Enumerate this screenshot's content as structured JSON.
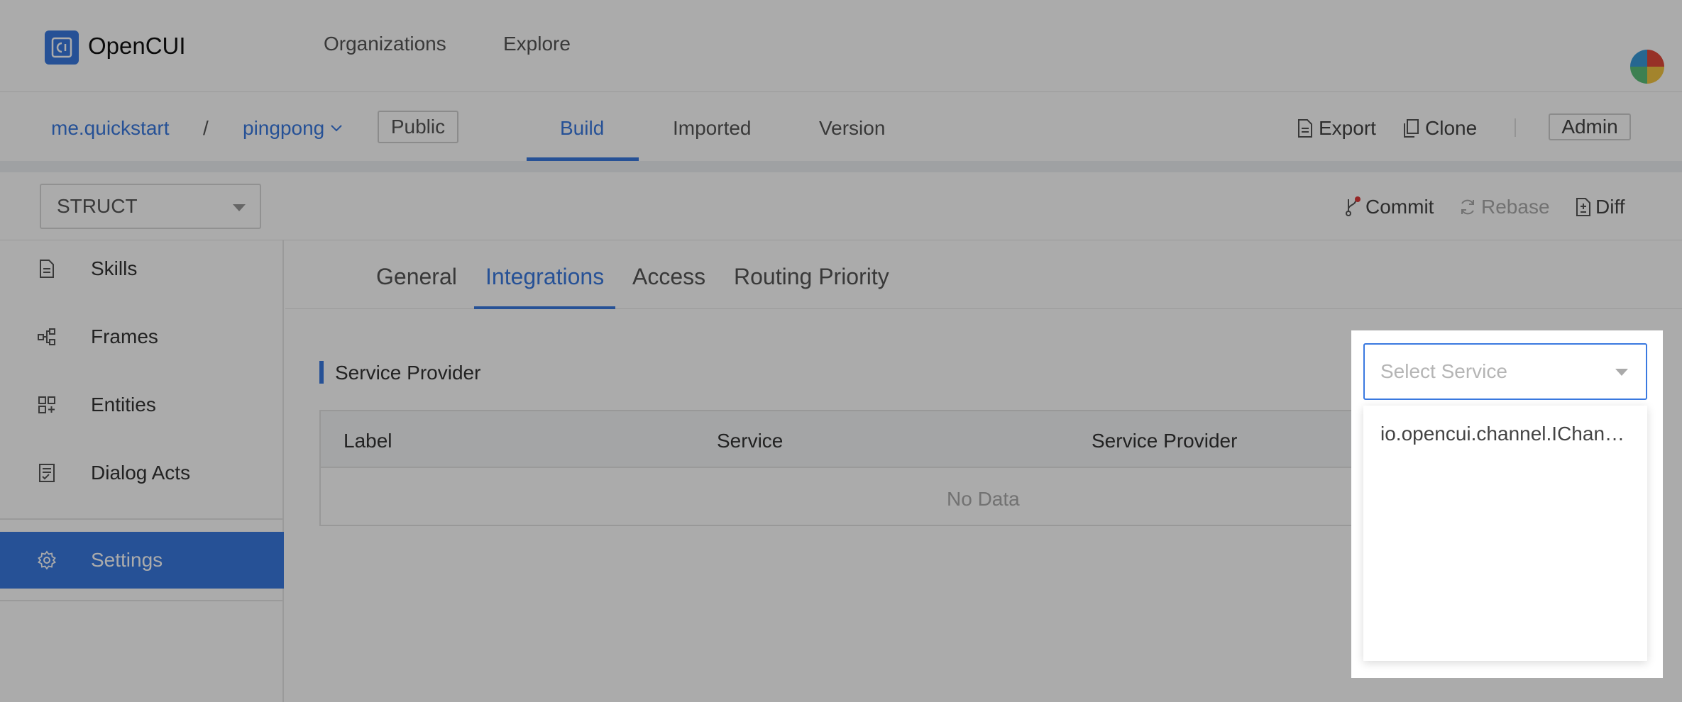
{
  "header": {
    "app_name": "OpenCUI",
    "nav": [
      "Organizations",
      "Explore"
    ]
  },
  "project_bar": {
    "org": "me.quickstart",
    "separator": "/",
    "project": "pingpong",
    "visibility": "Public",
    "tabs": [
      "Build",
      "Imported",
      "Version"
    ],
    "active_tab": "Build",
    "actions": {
      "export": "Export",
      "clone": "Clone",
      "admin": "Admin"
    }
  },
  "toolbar": {
    "struct_value": "STRUCT",
    "commit": "Commit",
    "rebase": "Rebase",
    "diff": "Diff"
  },
  "sidebar": {
    "items": [
      {
        "label": "Skills",
        "icon": "file-icon"
      },
      {
        "label": "Frames",
        "icon": "frames-icon"
      },
      {
        "label": "Entities",
        "icon": "entities-icon"
      },
      {
        "label": "Dialog Acts",
        "icon": "dialog-acts-icon"
      },
      {
        "label": "Settings",
        "icon": "gear-icon",
        "active": true
      }
    ]
  },
  "content": {
    "tabs": [
      "General",
      "Integrations",
      "Access",
      "Routing Priority"
    ],
    "active_tab": "Integrations",
    "section_title": "Service Provider",
    "table": {
      "columns": [
        "Label",
        "Service",
        "Service Provider"
      ],
      "empty_text": "No Data"
    },
    "service_select": {
      "placeholder": "Select Service",
      "options": [
        "io.opencui.channel.IChan…"
      ]
    }
  },
  "colors": {
    "accent": "#3a79e0",
    "overlay": "rgba(0,0,0,0.33)"
  }
}
